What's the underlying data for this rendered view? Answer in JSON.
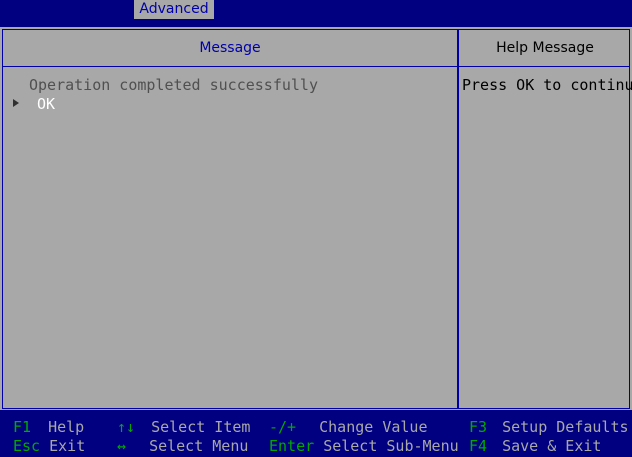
{
  "topbar": {
    "active_tab": "Advanced"
  },
  "message_panel": {
    "header": "Message",
    "text": "Operation completed successfully",
    "option_label": "OK"
  },
  "help_panel": {
    "header": "Help Message",
    "text": "Press OK to continue"
  },
  "footer": {
    "items": [
      {
        "key": "F1",
        "desc": "Help"
      },
      {
        "key": "Esc",
        "desc": "Exit"
      },
      {
        "key": "↑↓",
        "desc": "Select Item"
      },
      {
        "key": "↔",
        "desc": "Select Menu"
      },
      {
        "key": "-/+",
        "desc": "Change Value"
      },
      {
        "key": "Enter",
        "desc": "Select Sub-Menu"
      },
      {
        "key": "F3",
        "desc": "Setup Defaults"
      },
      {
        "key": "F4",
        "desc": "Save & Exit"
      }
    ]
  },
  "colors": {
    "background": "#000080",
    "panel": "#a8a8a8",
    "frame": "#0000a8",
    "key_text": "#00a800",
    "highlight_text": "#ffffff"
  }
}
